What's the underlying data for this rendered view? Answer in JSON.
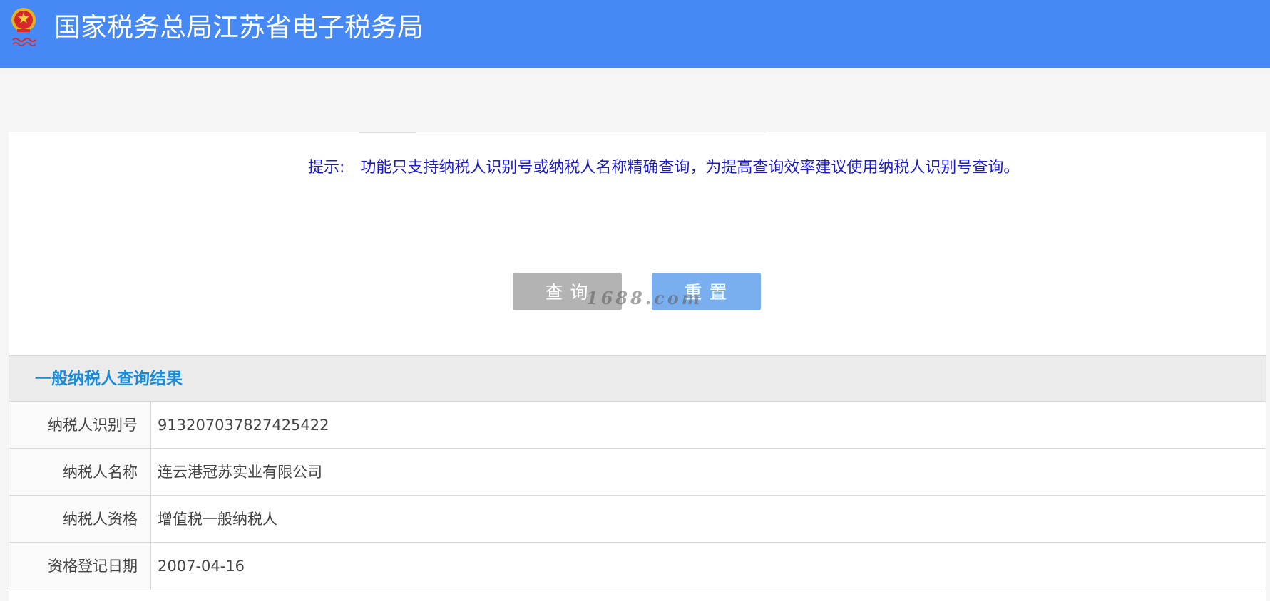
{
  "header": {
    "title": "国家税务总局江苏省电子税务局",
    "emblem_icon": "national-tax-emblem-icon",
    "colors": {
      "background": "#4689f4",
      "text": "#ffffff"
    }
  },
  "search": {
    "hint_label": "提示:",
    "hint_text": "功能只支持纳税人识别号或纳税人名称精确查询，为提高查询效率建议使用纳税人识别号查询。",
    "query_button": "查询",
    "reset_button": "重置",
    "watermark": "1688.com",
    "colors": {
      "hint": "#1b1bc9",
      "query_button": "#b3b3b3",
      "reset_button": "#7aafef"
    }
  },
  "results": {
    "title": "一般纳税人查询结果",
    "rows": [
      {
        "label": "纳税人识别号",
        "value": "913207037827425422"
      },
      {
        "label": "纳税人名称",
        "value": "连云港冠苏实业有限公司"
      },
      {
        "label": "纳税人资格",
        "value": "增值税一般纳税人"
      },
      {
        "label": "资格登记日期",
        "value": "2007-04-16"
      }
    ],
    "colors": {
      "title": "#1d8ad6",
      "header_bg": "#ebebeb",
      "border": "#d9d9d9"
    }
  }
}
